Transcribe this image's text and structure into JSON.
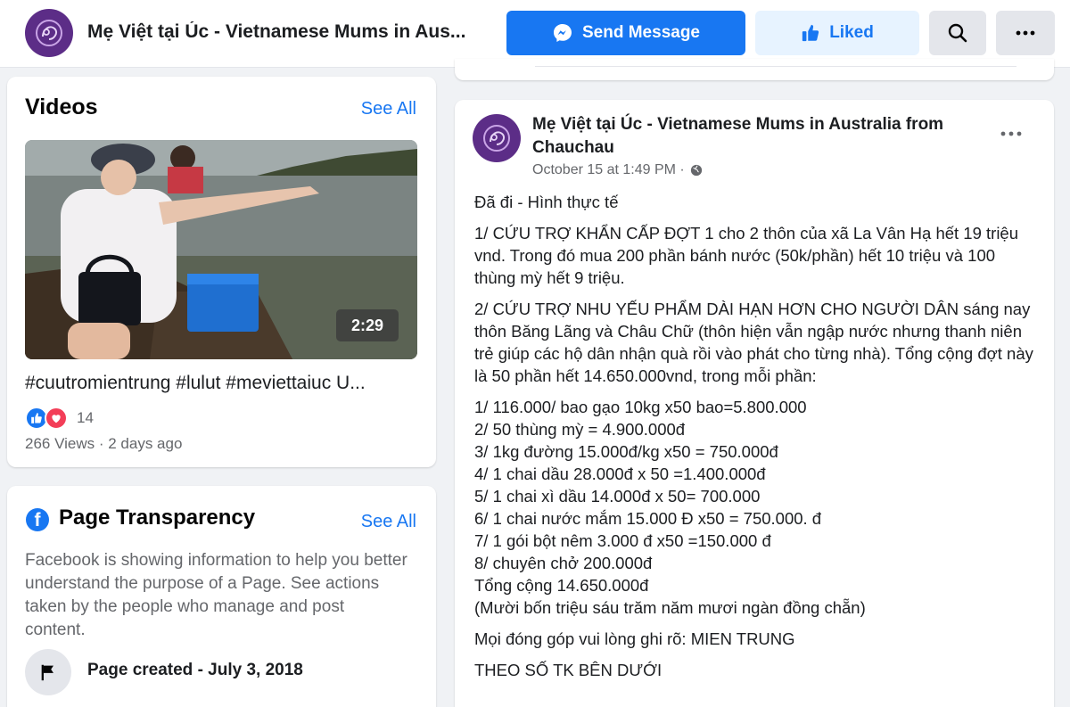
{
  "header": {
    "page_name": "Mẹ Việt tại Úc - Vietnamese Mums in Aus...",
    "send_message_label": "Send Message",
    "liked_label": "Liked"
  },
  "videos": {
    "title": "Videos",
    "see_all": "See All",
    "video_duration": "2:29",
    "video_title": "#cuutromientrung #lulut #meviettaiuc U...",
    "reaction_count": "14",
    "meta": "266 Views · 2 days ago"
  },
  "transparency": {
    "title": "Page Transparency",
    "see_all": "See All",
    "description": "Facebook is showing information to help you better understand the purpose of a Page. See actions taken by the people who manage and post content.",
    "page_created": "Page created - July 3, 2018"
  },
  "post": {
    "author": "Mẹ Việt tại Úc - Vietnamese Mums in Australia from Chauchau",
    "time": "October 15 at 1:49 PM ·",
    "p1": "Đã đi - Hình thực tế",
    "p2": "1/ CỨU TRỢ KHẨN CẤP ĐỢT 1 cho 2 thôn của xã La Vân Hạ hết 19 triệu vnd. Trong đó mua 200 phần bánh nước (50k/phần) hết 10 triệu và 100 thùng mỳ hết 9 triệu.",
    "p3": "2/ CỨU TRỢ NHU YẾU PHẨM DÀI HẠN HƠN CHO NGƯỜI DÂN sáng nay thôn Băng Lãng và Châu Chữ (thôn hiện vẫn ngập nước nhưng thanh niên trẻ giúp các hộ dân nhận quà rồi vào phát cho từng nhà). Tổng cộng đợt này là 50 phần hết 14.650.000vnd, trong mỗi phần:",
    "items": [
      "1/ 116.000/ bao gạo 10kg x50 bao=5.800.000",
      "2/ 50 thùng mỳ = 4.900.000đ",
      "3/  1kg đường 15.000đ/kg x50 = 750.000đ",
      "4/  1 chai dầu 28.000đ x 50 =1.400.000đ",
      "5/  1 chai xì dầu  14.000đ x 50= 700.000",
      "6/ 1 chai nước mắm 15.000 Đ x50  = 750.000. đ",
      "7/  1 gói bột nêm 3.000 đ x50  =150.000 đ",
      "8/ chuyên chở 200.000đ",
      "Tổng cộng 14.650.000đ",
      "(Mười bốn triệu sáu trăm năm mươi ngàn đồng chẵn)"
    ],
    "p4": "Mọi đóng góp vui lòng ghi rõ: MIEN TRUNG",
    "p5": "THEO SỐ TK BÊN DƯỚI"
  },
  "colors": {
    "brand_blue": "#1877f2",
    "liked_bg": "#e7f3ff",
    "avatar_purple": "#5c2d87",
    "love_red": "#f33e58"
  },
  "icons": [
    "messenger-icon",
    "thumbs-up-icon",
    "search-icon",
    "more-icon",
    "globe-icon",
    "flag-icon",
    "facebook-logo-icon",
    "like-reaction-icon",
    "love-reaction-icon"
  ]
}
